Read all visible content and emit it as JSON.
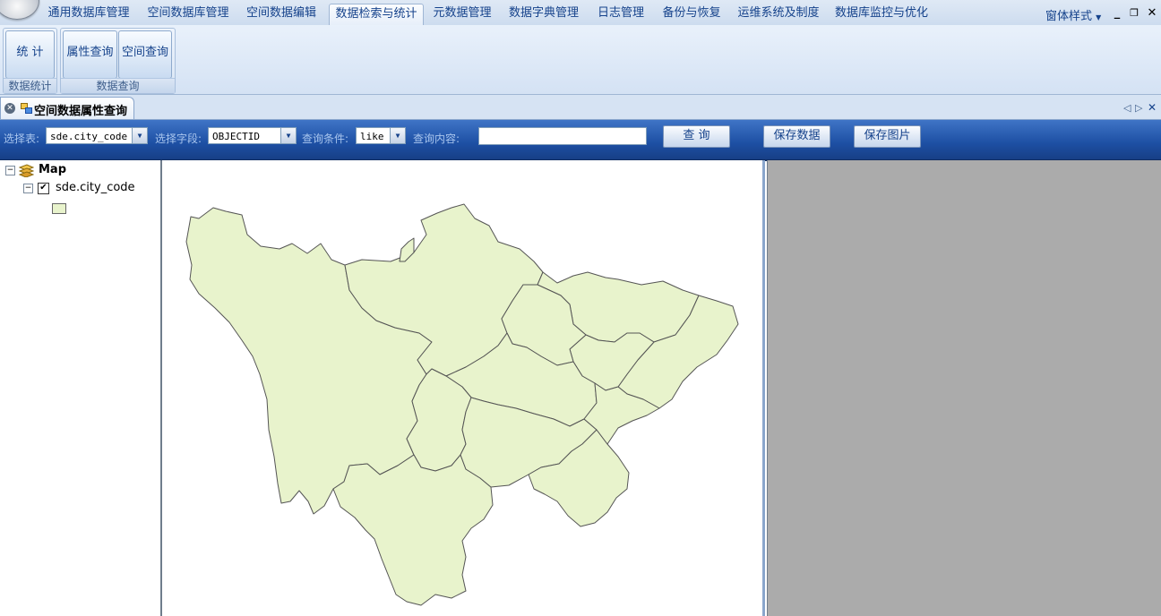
{
  "menu_tabs": [
    {
      "label": "通用数据库管理"
    },
    {
      "label": "空间数据库管理"
    },
    {
      "label": "空间数据编辑"
    },
    {
      "label": "数据检索与统计"
    },
    {
      "label": "元数据管理"
    },
    {
      "label": "数据字典管理"
    },
    {
      "label": "日志管理"
    },
    {
      "label": "备份与恢复"
    },
    {
      "label": "运维系统及制度"
    },
    {
      "label": "数据库监控与优化"
    }
  ],
  "active_tab": "数据检索与统计",
  "window_style_label": "窗体样式",
  "ribbon": {
    "stat_button": "统 计",
    "stat_group": "数据统计",
    "attr_query_button": "属性查询",
    "spatial_query_button": "空间查询",
    "query_group": "数据查询"
  },
  "doc_tab_title": "空间数据属性查询",
  "query_bar": {
    "table_label": "选择表:",
    "table_value": "sde.city_code",
    "field_label": "选择字段:",
    "field_value": "OBJECTID",
    "condition_label": "查询条件:",
    "condition_value": "like",
    "content_label": "查询内容:",
    "content_value": "",
    "query_button": "查 询",
    "save_data_button": "保存数据",
    "save_image_button": "保存图片"
  },
  "toc": {
    "map_label": "Map",
    "layer_label": "sde.city_code"
  },
  "colors": {
    "polygon_fill": "#e8f3cc",
    "polygon_stroke": "#555555",
    "toolbar_blue": "#1d4fa3",
    "right_panel": "#ababab"
  }
}
